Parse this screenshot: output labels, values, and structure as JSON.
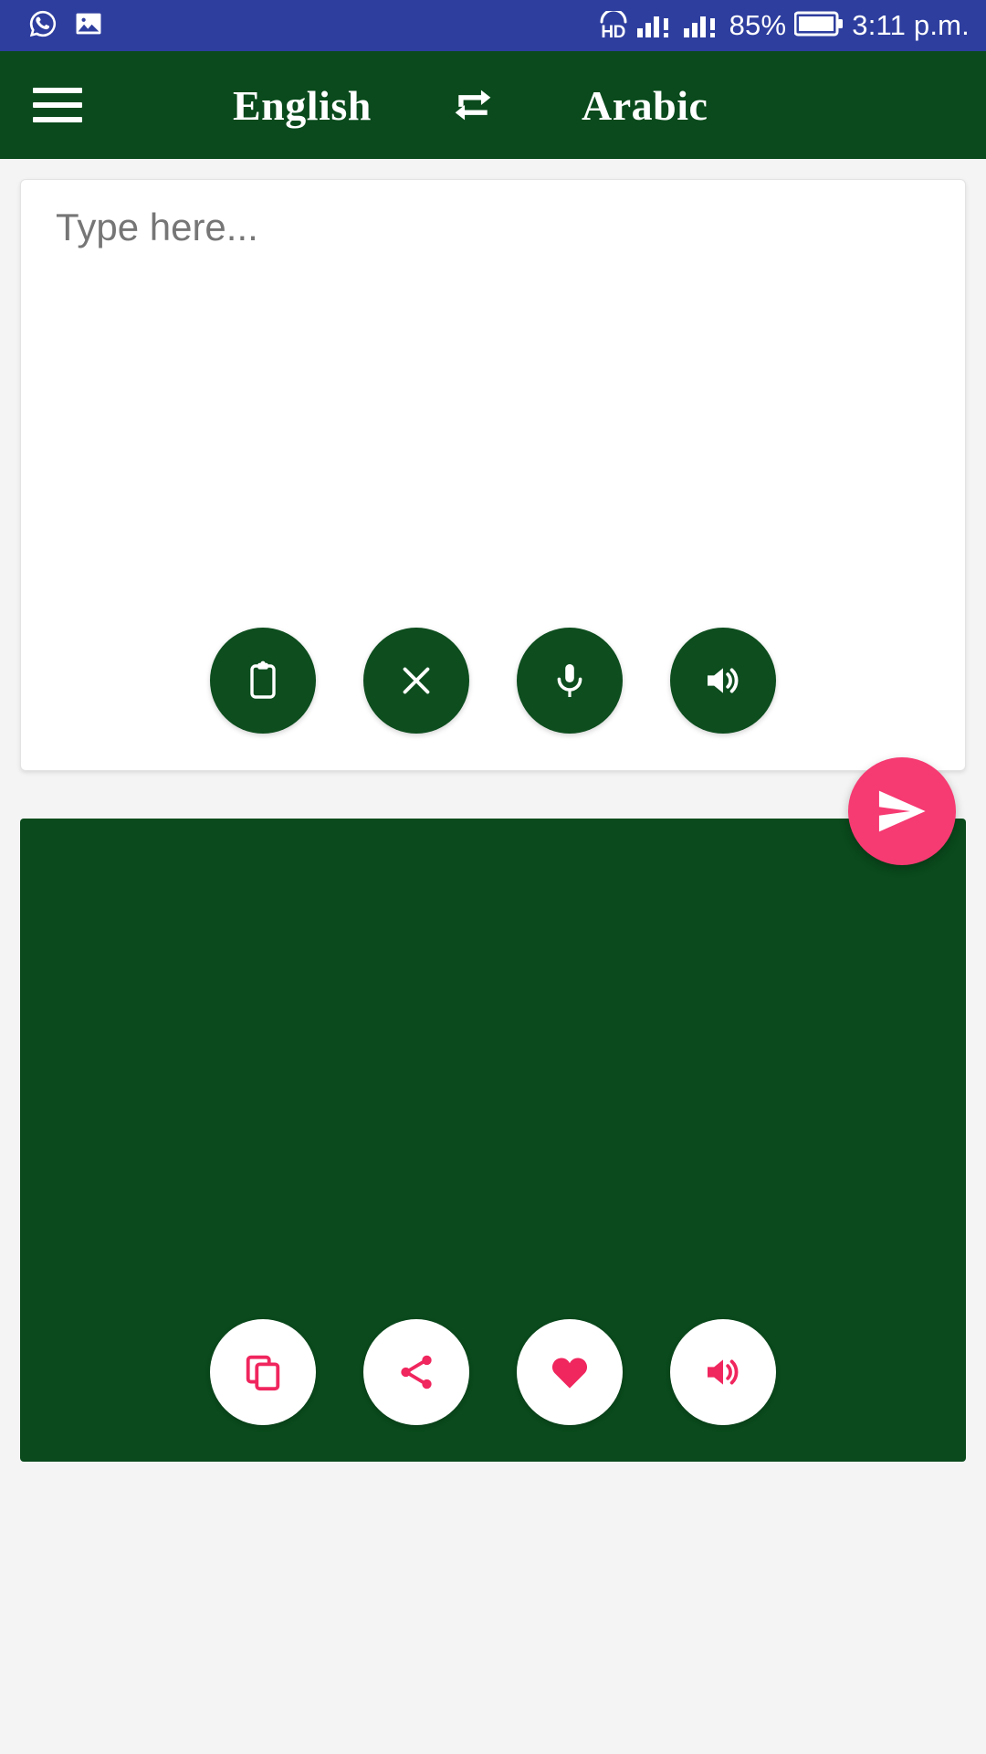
{
  "status_bar": {
    "background_color": "#2e3e9e",
    "left_icons": [
      {
        "name": "whatsapp-icon",
        "label": "WhatsApp"
      },
      {
        "name": "image-icon",
        "label": "Screenshot saved"
      }
    ],
    "hd_label": "HD",
    "signal_1": "signal-bars-1",
    "signal_2": "signal-bars-2",
    "battery_percent": "85%",
    "battery_icon": "battery-icon",
    "time": "3:11 p.m."
  },
  "app_bar": {
    "background_color": "#0a4a1c",
    "menu_icon": "hamburger-menu-icon",
    "source_language": "English",
    "swap_icon": "swap-languages-icon",
    "target_language": "Arabic"
  },
  "input_card": {
    "placeholder": "Type here...",
    "value": "",
    "background_color": "#ffffff",
    "actions": [
      {
        "name": "paste-button",
        "icon": "clipboard-icon",
        "label": "Paste"
      },
      {
        "name": "clear-button",
        "icon": "close-icon",
        "label": "Clear"
      },
      {
        "name": "voice-input-button",
        "icon": "microphone-icon",
        "label": "Speak"
      },
      {
        "name": "speak-source-button",
        "icon": "speaker-icon",
        "label": "Listen"
      }
    ]
  },
  "send_button": {
    "name": "translate-send-button",
    "icon": "send-icon",
    "label": "Translate",
    "color": "#f63a72"
  },
  "output_card": {
    "text": "",
    "background_color": "#0a4a1c",
    "actions": [
      {
        "name": "copy-button",
        "icon": "copy-icon",
        "label": "Copy"
      },
      {
        "name": "share-button",
        "icon": "share-icon",
        "label": "Share"
      },
      {
        "name": "favorite-button",
        "icon": "heart-icon",
        "label": "Favorite"
      },
      {
        "name": "speak-result-button",
        "icon": "speaker-icon",
        "label": "Listen"
      }
    ],
    "accent_color": "#f0265e"
  }
}
